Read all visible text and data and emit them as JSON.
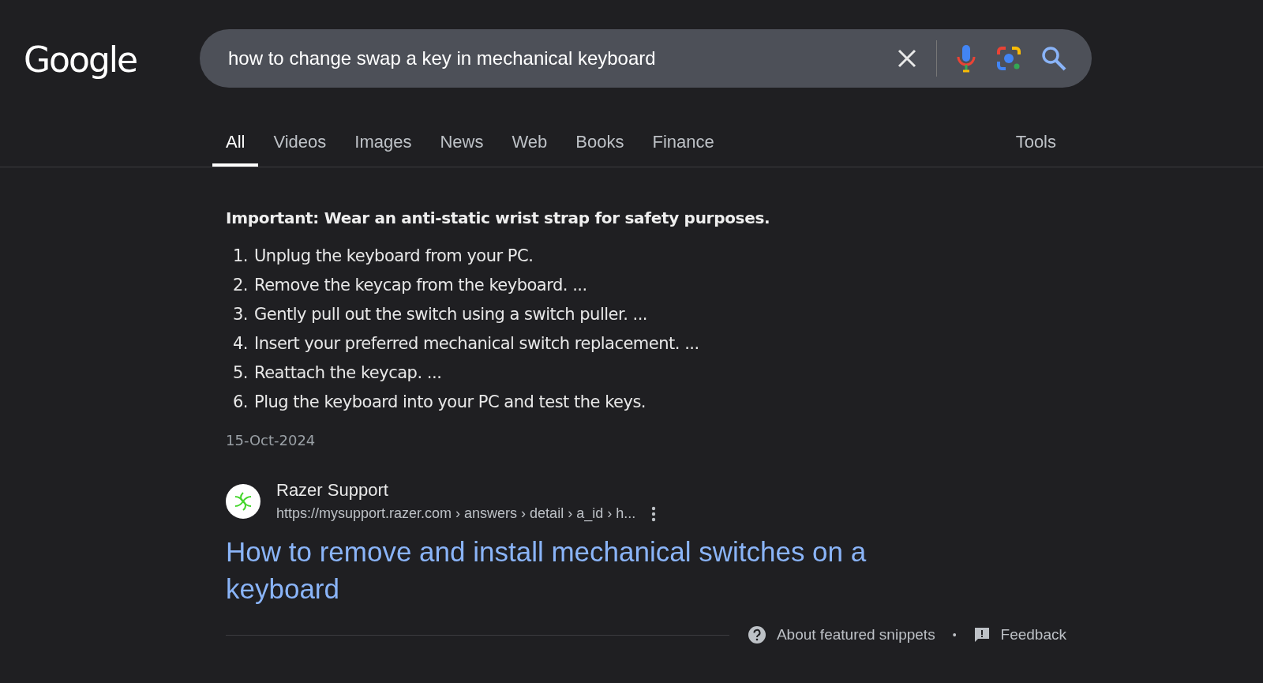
{
  "header": {
    "logo": "Google",
    "search": {
      "value": "how to change swap a key in mechanical keyboard"
    }
  },
  "tabs": [
    {
      "label": "All",
      "selected": true
    },
    {
      "label": "Videos",
      "selected": false
    },
    {
      "label": "Images",
      "selected": false
    },
    {
      "label": "News",
      "selected": false
    },
    {
      "label": "Web",
      "selected": false
    },
    {
      "label": "Books",
      "selected": false
    },
    {
      "label": "Finance",
      "selected": false
    }
  ],
  "tools": "Tools",
  "snippet": {
    "heading": "Important: Wear an anti-static wrist strap for safety purposes.",
    "steps": [
      {
        "number": "1.",
        "text": "Unplug the keyboard from your PC."
      },
      {
        "number": "2.",
        "text": "Remove the keycap from the keyboard. ..."
      },
      {
        "number": "3.",
        "text": "Gently pull out the switch using a switch puller. ..."
      },
      {
        "number": "4.",
        "text": "Insert your preferred mechanical switch replacement. ..."
      },
      {
        "number": "5.",
        "text": "Reattach the keycap. ..."
      },
      {
        "number": "6.",
        "text": "Plug the keyboard into your PC and test the keys."
      }
    ],
    "date": "15-Oct-2024"
  },
  "result": {
    "site": "Razer Support",
    "url": "https://mysupport.razer.com › answers › detail › a_id › h...",
    "title": "How to remove and install mechanical switches on a keyboard"
  },
  "footer": {
    "about": "About featured snippets",
    "separator": "•",
    "feedback": "Feedback"
  }
}
